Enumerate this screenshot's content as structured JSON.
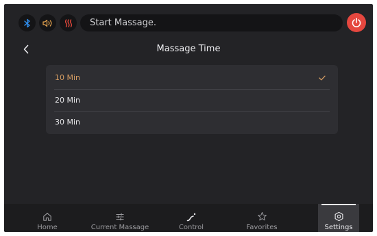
{
  "status": {
    "message": "Start Massage.",
    "icons": [
      "bluetooth-icon",
      "speaker-icon",
      "heat-icon",
      "power-icon"
    ],
    "colors": {
      "bluetooth": "#2f8ff0",
      "speaker": "#e2a14e",
      "heat": "#e0473a",
      "power": "#e5473f"
    }
  },
  "header": {
    "title": "Massage Time",
    "back_icon": "chevron-left-icon"
  },
  "options": [
    {
      "label": "10 Min",
      "selected": true
    },
    {
      "label": "20 Min",
      "selected": false
    },
    {
      "label": "30 Min",
      "selected": false
    }
  ],
  "accent_color": "#d39b62",
  "nav": [
    {
      "label": "Home",
      "icon": "home-icon"
    },
    {
      "label": "Current Massage",
      "icon": "sliders-icon"
    },
    {
      "label": "Control",
      "icon": "curve-icon"
    },
    {
      "label": "Favorites",
      "icon": "star-icon"
    },
    {
      "label": "Settings",
      "icon": "gear-icon",
      "active": true
    }
  ]
}
